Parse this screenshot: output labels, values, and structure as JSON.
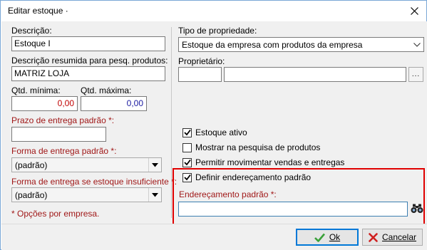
{
  "window": {
    "title": "Editar estoque ·"
  },
  "left": {
    "descricao_label": "Descrição:",
    "descricao_value": "Estoque I",
    "resumida_label": "Descrição resumida para pesq. produtos:",
    "resumida_value": "MATRIZ LOJA",
    "qtd_min_label": "Qtd. mínima:",
    "qtd_min_value": "0,00",
    "qtd_max_label": "Qtd. máxima:",
    "qtd_max_value": "0,00",
    "prazo_label": "Prazo de entrega padrão *:",
    "prazo_value": "",
    "forma_label": "Forma de entrega padrão *:",
    "forma_value": "(padrão)",
    "forma_insuf_label": "Forma de entrega se estoque insuficiente *:",
    "forma_insuf_value": "(padrão)",
    "note": "* Opções por empresa."
  },
  "right": {
    "tipo_label": "Tipo de propriedade:",
    "tipo_value": "Estoque da empresa com produtos da empresa",
    "proprietario_label": "Proprietário:",
    "proprietario_code": "",
    "proprietario_name": "",
    "ellipsis_label": "...",
    "checkboxes": [
      {
        "label": "Estoque ativo",
        "checked": true
      },
      {
        "label": "Mostrar na pesquisa de produtos",
        "checked": false
      },
      {
        "label": "Permitir movimentar vendas e entregas",
        "checked": true
      },
      {
        "label": "Definir endereçamento padrão",
        "checked": true
      }
    ],
    "enderecamento_label": "Endereçamento padrão *:",
    "enderecamento_value": ""
  },
  "footer": {
    "ok_label": "Ok",
    "cancel_label": "Cancelar"
  },
  "colors": {
    "required_label": "#a01818",
    "highlight_border": "#e00000",
    "number_red": "#c00000",
    "number_blue": "#1a1aa0",
    "ok_check": "#3aa13a",
    "cancel_x": "#d02020"
  },
  "icons": [
    "close-icon",
    "chevron-down-icon",
    "checkmark-icon",
    "binoculars-icon",
    "ok-check-icon",
    "cancel-x-icon"
  ]
}
